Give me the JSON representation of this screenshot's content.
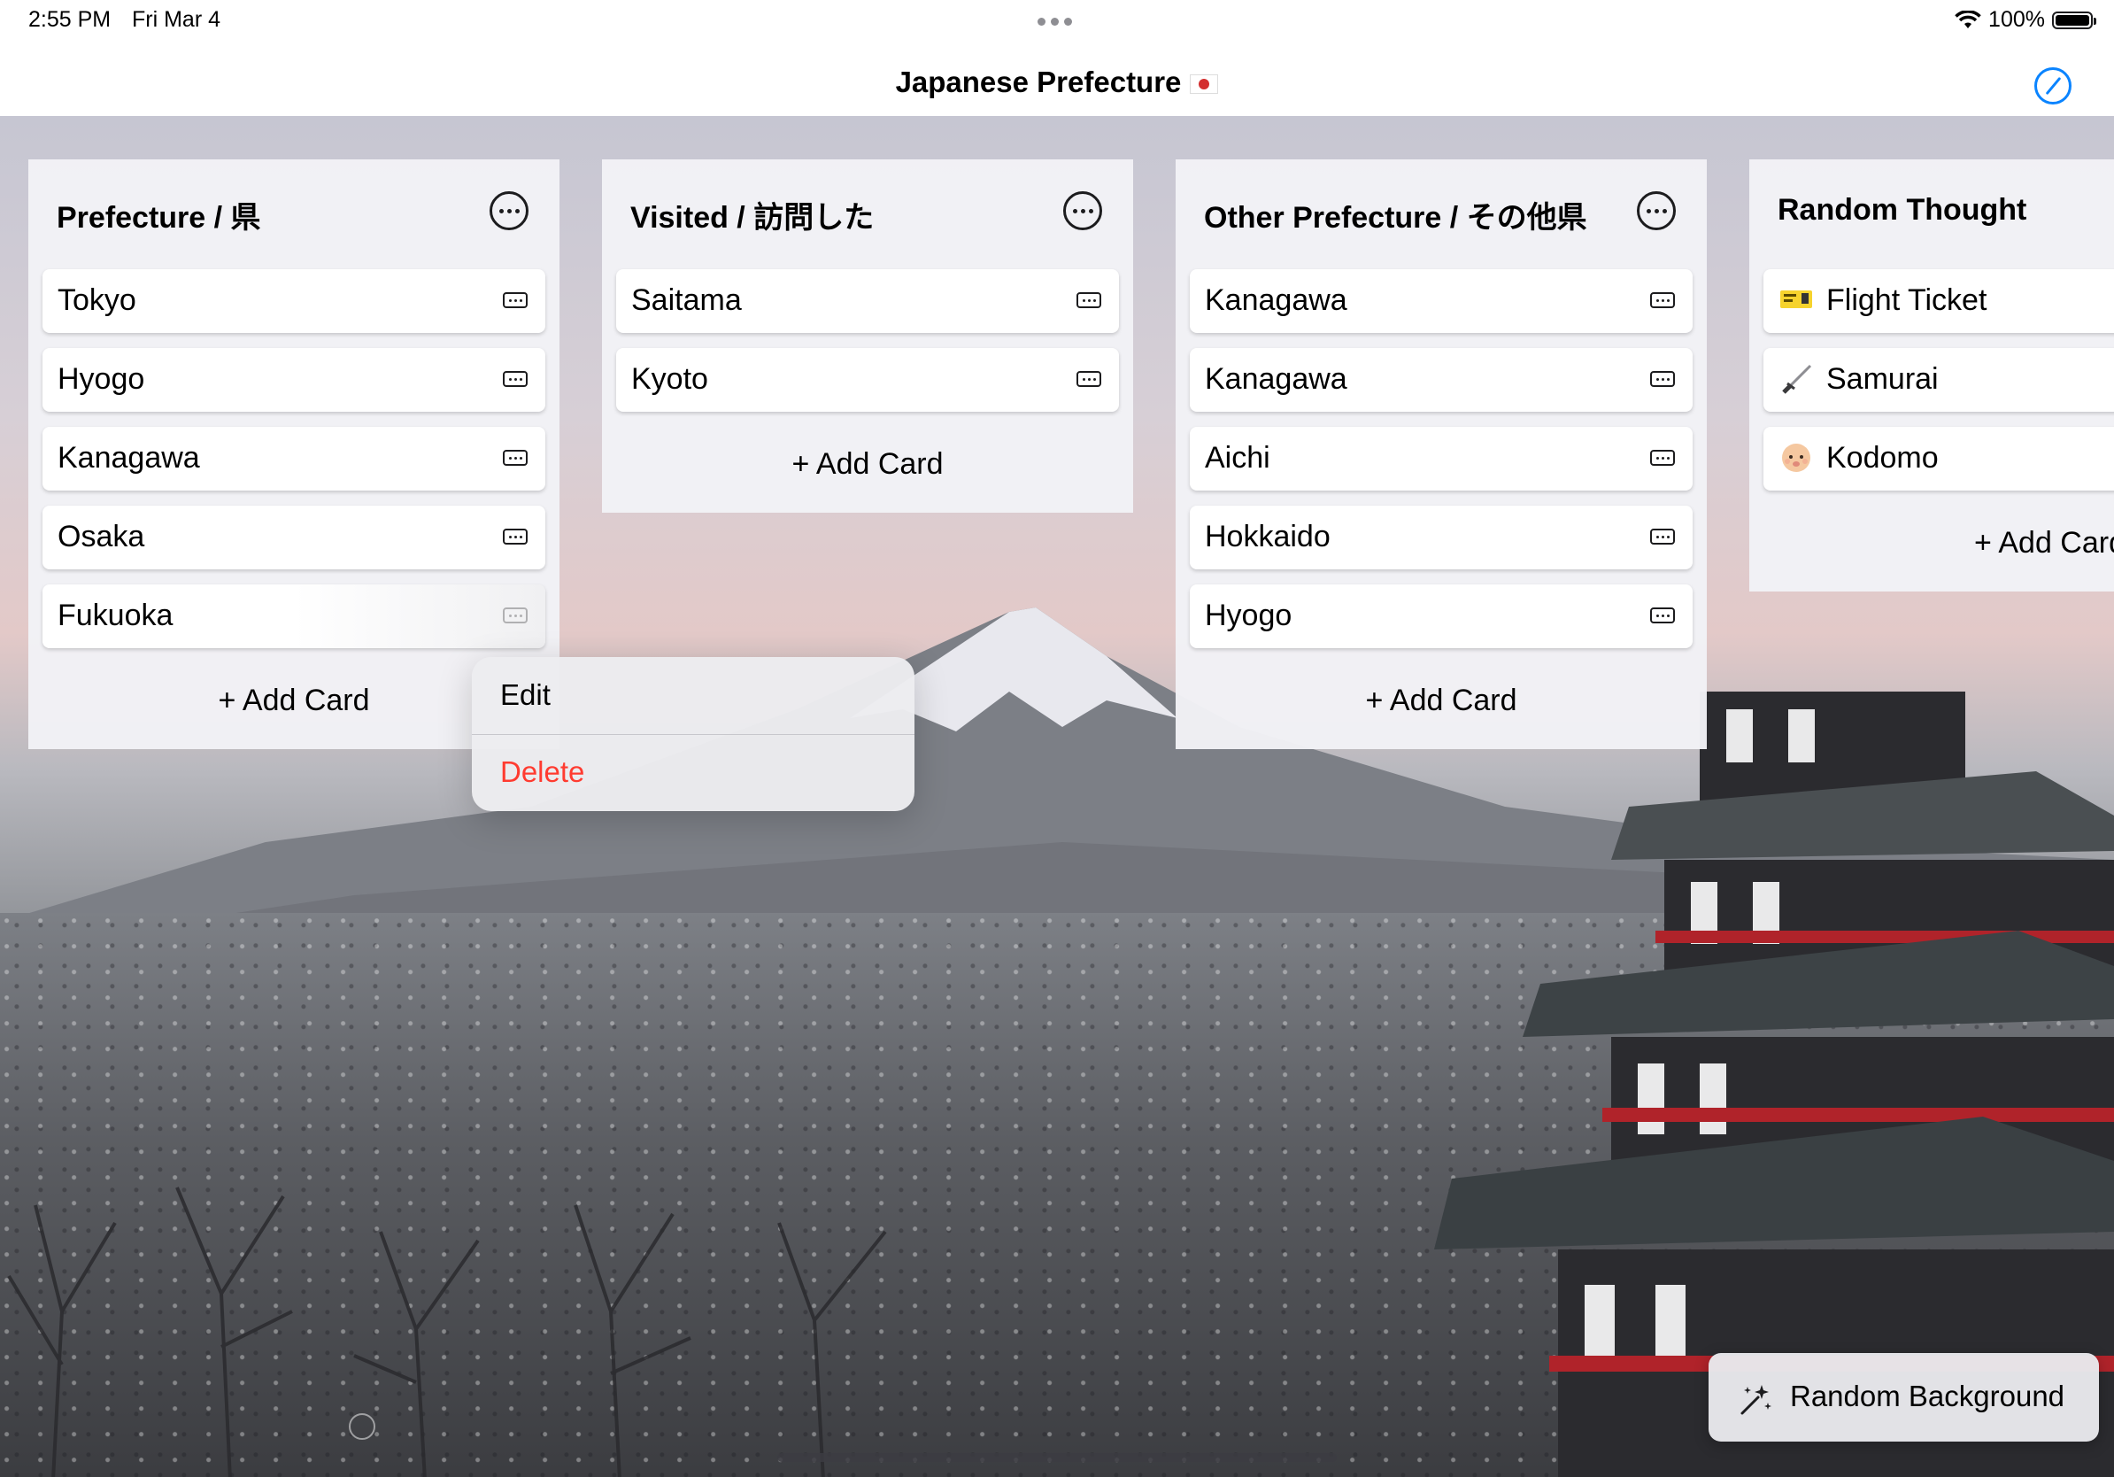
{
  "status_bar": {
    "time": "2:55 PM",
    "date": "Fri Mar 4",
    "battery": "100%",
    "battery_level": 1.0
  },
  "nav": {
    "title": "Japanese Prefecture",
    "title_flag_icon": "japan-flag-icon",
    "compose_icon": "compose-icon",
    "accent_color": "#0a84ff"
  },
  "lists": [
    {
      "title": "Prefecture / 県",
      "more_icon": "ellipsis-circle-icon",
      "cards": [
        "Tokyo",
        "Hyogo",
        "Kanagawa",
        "Osaka",
        "Fukuoka"
      ],
      "add_label": "+ Add Card"
    },
    {
      "title": "Visited / 訪問した",
      "more_icon": "ellipsis-circle-icon",
      "cards": [
        "Saitama",
        "Kyoto"
      ],
      "add_label": "+ Add Card"
    },
    {
      "title": "Other Prefecture / その他県",
      "more_icon": "ellipsis-circle-icon",
      "cards": [
        "Kanagawa",
        "Kanagawa",
        "Aichi",
        "Hokkaido",
        "Hyogo"
      ],
      "add_label": "+ Add Card"
    },
    {
      "title": "Random Thought",
      "cards": [
        "Flight Ticket",
        "Samurai",
        "Kodomo"
      ],
      "card_icons": [
        "ticket-emoji-icon",
        "sword-emoji-icon",
        "baby-emoji-icon"
      ],
      "add_label": "+ Add Card"
    }
  ],
  "context_menu": {
    "edit": "Edit",
    "delete": "Delete",
    "delete_color": "#ff3b30"
  },
  "random_background": {
    "label": "Random Background",
    "icon": "sparkles-icon"
  }
}
